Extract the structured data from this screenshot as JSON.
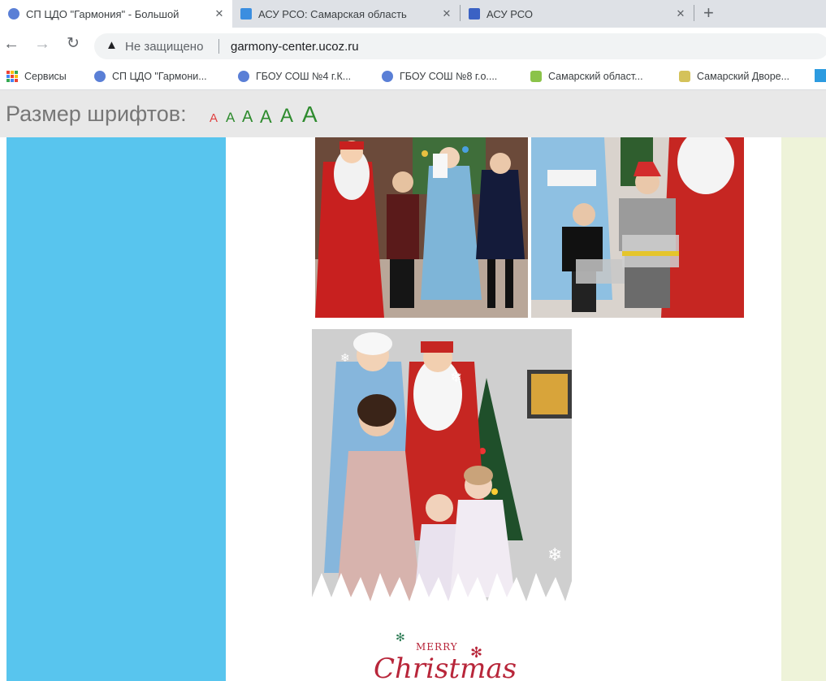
{
  "browser": {
    "tabs": [
      {
        "title": "СП ЦДО \"Гармония\" - Большой",
        "active": true
      },
      {
        "title": "АСУ РСО: Самарская область",
        "active": false
      },
      {
        "title": "АСУ РСО",
        "active": false
      }
    ],
    "new_tab_label": "+",
    "security_label": "Не защищено",
    "url": "garmony-center.ucoz.ru"
  },
  "bookmarks": [
    {
      "label": "Сервисы",
      "icon": "apps-icon"
    },
    {
      "label": "СП ЦДО \"Гармони...",
      "icon": "site-icon"
    },
    {
      "label": "ГБОУ СОШ №4 г.К...",
      "icon": "site-icon"
    },
    {
      "label": "ГБОУ СОШ №8 г.о....",
      "icon": "site-icon"
    },
    {
      "label": "Самарский област...",
      "icon": "site-icon"
    },
    {
      "label": "Самарский Дворе...",
      "icon": "site-icon"
    }
  ],
  "font_size": {
    "label": "Размер шрифтов:",
    "options": [
      "A",
      "A",
      "A",
      "A",
      "A",
      "A"
    ]
  },
  "card": {
    "merry": "MERRY",
    "christmas": "Christmas"
  },
  "colors": {
    "left_column": "#58c5ee",
    "right_column": "#eef3d9",
    "font_link": "#2e8b2e",
    "font_link_active": "#e04040"
  }
}
